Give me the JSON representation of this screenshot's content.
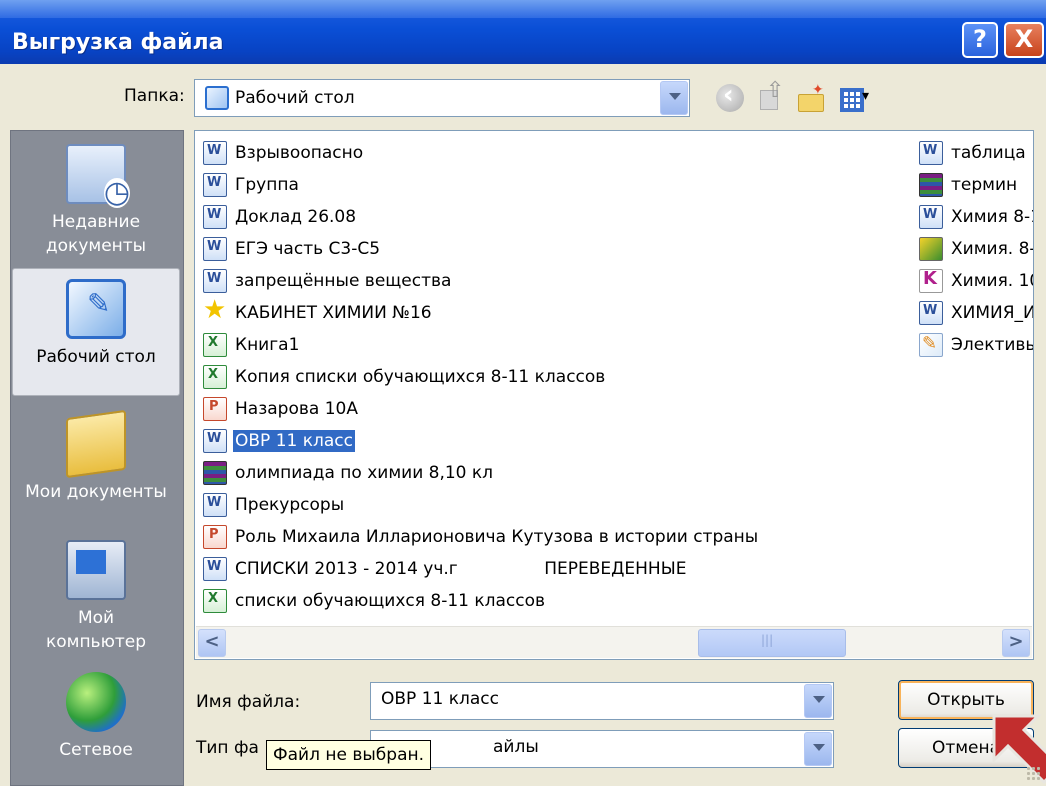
{
  "window": {
    "title": "Выгрузка файла",
    "help_label": "?",
    "close_label": "X"
  },
  "folder": {
    "label": "Папка:",
    "value": "Рабочий стол"
  },
  "toolbar": {
    "icons": [
      "back-icon",
      "up-folder-icon",
      "new-folder-icon",
      "views-menu-icon"
    ]
  },
  "places": [
    {
      "label": "Недавние\nдокументы",
      "icon": "recent-documents-icon"
    },
    {
      "label": "Рабочий стол",
      "icon": "desktop-icon"
    },
    {
      "label": "Мои документы",
      "icon": "my-documents-icon"
    },
    {
      "label": "Мой\nкомпьютер",
      "icon": "my-computer-icon"
    },
    {
      "label": "Сетевое",
      "icon": "network-icon"
    }
  ],
  "files_col1": [
    {
      "name": "Взрывоопасно",
      "type": "word"
    },
    {
      "name": "Группа",
      "type": "word"
    },
    {
      "name": "Доклад 26.08",
      "type": "word"
    },
    {
      "name": "ЕГЭ часть С3-С5",
      "type": "word"
    },
    {
      "name": "запрещённые вещества",
      "type": "word"
    },
    {
      "name": "КАБИНЕТ ХИМИИ №16",
      "type": "star"
    },
    {
      "name": "Книга1",
      "type": "excel"
    },
    {
      "name": "Копия списки обучающихся 8-11 классов",
      "type": "excel"
    },
    {
      "name": "Назарова 10А",
      "type": "ppt"
    },
    {
      "name": "ОВР 11 класс",
      "type": "word",
      "selected": true
    },
    {
      "name": "олимпиада по химии 8,10 кл",
      "type": "rar"
    },
    {
      "name": "Прекурсоры",
      "type": "word"
    },
    {
      "name": "Роль  Михаила Илларионовича Кутузова в истории страны",
      "type": "ppt"
    },
    {
      "name": "СПИСКИ 2013 - 2014 уч.г                ПЕРЕВЕДЕННЫЕ",
      "type": "word"
    },
    {
      "name": "списки обучающихся 8-11 классов",
      "type": "excel"
    }
  ],
  "files_col2": [
    {
      "name": "таблица",
      "type": "word"
    },
    {
      "name": "термин",
      "type": "rar"
    },
    {
      "name": "Химия 8-1",
      "type": "word"
    },
    {
      "name": "Химия. 8-",
      "type": "yellow"
    },
    {
      "name": "Химия. 10",
      "type": "k"
    },
    {
      "name": "ХИМИЯ_И",
      "type": "word"
    },
    {
      "name": "Элективы",
      "type": "pencil"
    }
  ],
  "filename": {
    "label": "Имя файла:",
    "value": "ОВР 11 класс"
  },
  "filetype": {
    "label": "Тип фа",
    "value": "айлы"
  },
  "tooltip": "Файл не выбран.",
  "buttons": {
    "open": "Открыть",
    "cancel": "Отмена"
  },
  "scrollbar": {
    "left_label": "<",
    "right_label": ">"
  }
}
